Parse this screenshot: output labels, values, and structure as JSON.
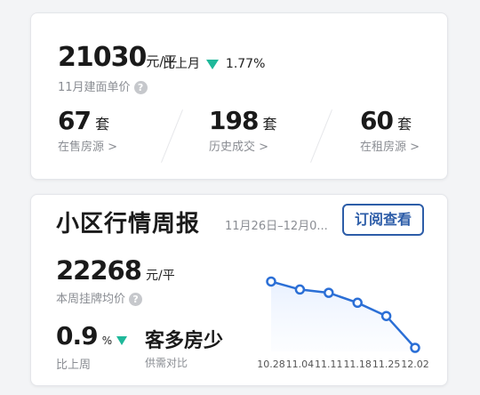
{
  "summary": {
    "price_value": "21030",
    "price_unit": "元/平",
    "mom_label": "比上月",
    "mom_change": "1.77%",
    "price_caption": "11月建面单价",
    "stats": [
      {
        "value": "67",
        "unit": "套",
        "label": "在售房源",
        "chevron": ">"
      },
      {
        "value": "198",
        "unit": "套",
        "label": "历史成交",
        "chevron": ">"
      },
      {
        "value": "60",
        "unit": "套",
        "label": "在租房源",
        "chevron": ">"
      }
    ]
  },
  "report": {
    "title": "小区行情周报",
    "date_range": "11月26日–12月0...",
    "subscribe_label": "订阅查看",
    "weekly_price": "22268",
    "weekly_price_unit": "元/平",
    "weekly_price_caption": "本周挂牌均价",
    "wow_value": "0.9",
    "wow_unit": "%",
    "wow_caption": "比上周",
    "supply_demand": "客多房少",
    "supply_demand_caption": "供需对比"
  },
  "chart_data": {
    "type": "line",
    "categories": [
      "10.28",
      "11.04",
      "11.11",
      "11.18",
      "11.25",
      "12.02"
    ],
    "values": [
      10,
      8.8,
      8.3,
      6.8,
      4.8,
      0
    ],
    "title": "",
    "xlabel": "",
    "ylabel": "",
    "ylim": [
      0,
      11
    ],
    "grid": false,
    "color": "#2b6fd6"
  },
  "colors": {
    "down_arrow": "#1fb89a",
    "accent_blue": "#2d5da8",
    "line_blue": "#2b6fd6"
  },
  "icons": {
    "help": "question-circle-icon",
    "down": "triangle-down-icon",
    "chevron": "chevron-right-icon"
  }
}
